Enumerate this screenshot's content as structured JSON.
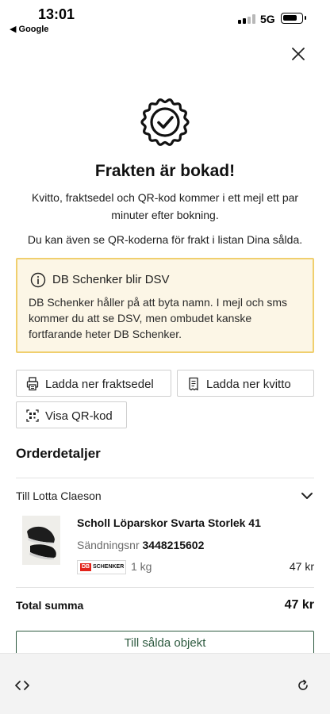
{
  "status_bar": {
    "time": "13:01",
    "back_app": "◀ Google",
    "network": "5G",
    "signal_bars_active": 2,
    "battery_level": 0.8
  },
  "header": {
    "close_icon": "close-icon"
  },
  "confirmation": {
    "badge_icon": "verified-check-badge-icon",
    "title": "Frakten är bokad!",
    "subtitle": "Kvitto, fraktsedel och QR-kod kommer i ett mejl ett par minuter efter bokning.",
    "note": "Du kan även se QR-koderna för frakt i listan Dina sålda."
  },
  "info_box": {
    "icon": "info-icon",
    "title": "DB Schenker blir DSV",
    "body": "DB Schenker håller på att byta namn. I mejl och sms kommer du att se DSV, men ombudet kanske fortfarande heter DB Schenker.",
    "colors": {
      "background": "#fcf6e6",
      "border": "#f0cf6e"
    }
  },
  "actions": {
    "download_waybill": "Ladda ner fraktsedel",
    "download_receipt": "Ladda ner kvitto",
    "show_qr": "Visa QR-kod"
  },
  "order": {
    "section_title": "Orderdetaljer",
    "recipient": "Till Lotta Claeson",
    "item": {
      "name": "Scholl Löparskor Svarta Storlek 41",
      "shipment_label": "Sändningsnr",
      "shipment_number": "3448215602",
      "carrier_logo_db": "DB",
      "carrier_logo_name": "SCHENKER",
      "weight": "1 kg",
      "price": "47 kr"
    },
    "total_label": "Total summa",
    "total_value": "47 kr"
  },
  "cta": {
    "label": "Till sålda objekt",
    "color": "#2d5a3f"
  },
  "toolbar": {
    "code_icon": "code-brackets-icon",
    "reload_icon": "reload-icon"
  }
}
